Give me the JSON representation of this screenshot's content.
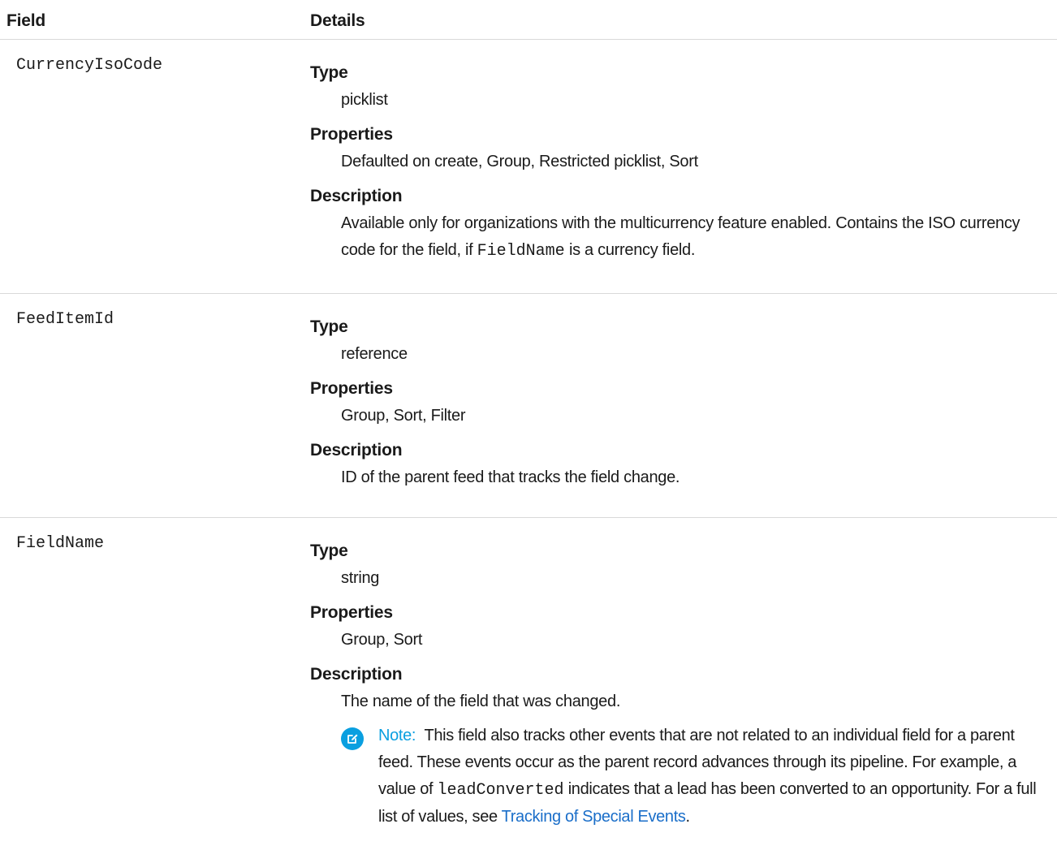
{
  "header": {
    "field": "Field",
    "details": "Details"
  },
  "rows": [
    {
      "name": "CurrencyIsoCode",
      "type_label": "Type",
      "type": "picklist",
      "properties_label": "Properties",
      "properties": "Defaulted on create, Group, Restricted picklist, Sort",
      "description_label": "Description",
      "description_part1": "Available only for organizations with the multicurrency feature enabled. Contains the ISO currency code for the field, if ",
      "description_code": "FieldName",
      "description_part2": " is a currency field."
    },
    {
      "name": "FeedItemId",
      "type_label": "Type",
      "type": "reference",
      "properties_label": "Properties",
      "properties": "Group, Sort, Filter",
      "description_label": "Description",
      "description": "ID of the parent feed that tracks the field change."
    },
    {
      "name": "FieldName",
      "type_label": "Type",
      "type": "string",
      "properties_label": "Properties",
      "properties": "Group, Sort",
      "description_label": "Description",
      "description": "The name of the field that was changed.",
      "note": {
        "label": "Note:",
        "text1": "This field also tracks other events that are not related to an individual field for a parent feed. These events occur as the parent record advances through its pipeline. For example, a value of ",
        "code": "leadConverted",
        "text2": " indicates that a lead has been converted to an opportunity. For a full list of values, see ",
        "link": "Tracking of Special Events",
        "text3": ".",
        "icon": "edit-note-icon",
        "icon_color": "#0a9fe0"
      }
    }
  ],
  "colors": {
    "text": "#1a1a1a",
    "divider": "#d9d9d9",
    "accent": "#0a9fe0",
    "link": "#1a6ec9"
  }
}
